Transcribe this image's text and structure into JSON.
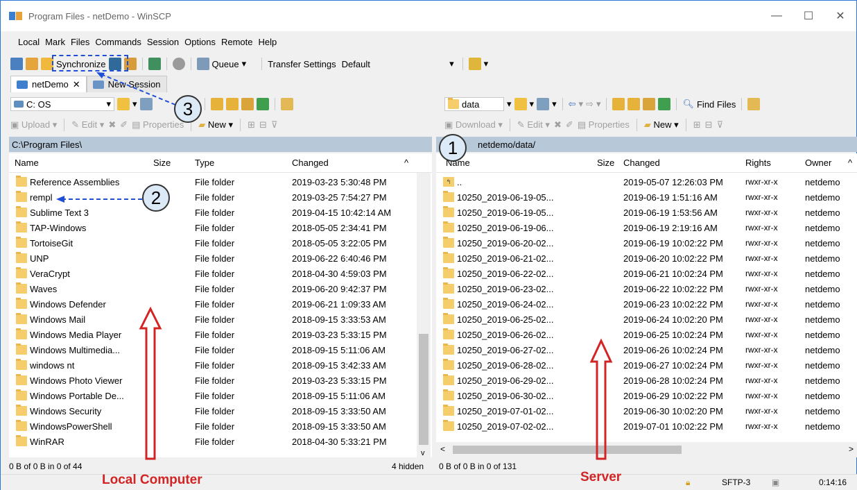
{
  "window": {
    "title": "Program Files - netDemo - WinSCP",
    "minimize": "—",
    "maximize": "☐",
    "close": "✕"
  },
  "menu": [
    "Local",
    "Mark",
    "Files",
    "Commands",
    "Session",
    "Options",
    "Remote",
    "Help"
  ],
  "toolbar": {
    "synchronize": "Synchronize",
    "queue": "Queue",
    "transfer_settings_label": "Transfer Settings",
    "transfer_settings_value": "Default"
  },
  "tabs": [
    {
      "label": "netDemo",
      "close": "✕"
    },
    {
      "label": "New Session"
    }
  ],
  "local": {
    "drive": "C: OS",
    "upload": "Upload",
    "edit": "Edit",
    "properties": "Properties",
    "new": "New",
    "path": "C:\\Program Files\\",
    "columns": {
      "name": "Name",
      "size": "Size",
      "type": "Type",
      "changed": "Changed"
    },
    "rows": [
      {
        "name": "Reference Assemblies",
        "type": "File folder",
        "changed": "2019-03-23 5:30:48 PM"
      },
      {
        "name": "rempl",
        "type": "File folder",
        "changed": "2019-03-25 7:54:27 PM"
      },
      {
        "name": "Sublime Text 3",
        "type": "File folder",
        "changed": "2019-04-15 10:42:14 AM"
      },
      {
        "name": "TAP-Windows",
        "type": "File folder",
        "changed": "2018-05-05 2:34:41 PM"
      },
      {
        "name": "TortoiseGit",
        "type": "File folder",
        "changed": "2018-05-05 3:22:05 PM"
      },
      {
        "name": "UNP",
        "type": "File folder",
        "changed": "2019-06-22 6:40:46 PM"
      },
      {
        "name": "VeraCrypt",
        "type": "File folder",
        "changed": "2018-04-30 4:59:03 PM"
      },
      {
        "name": "Waves",
        "type": "File folder",
        "changed": "2019-06-20 9:42:37 PM"
      },
      {
        "name": "Windows Defender",
        "type": "File folder",
        "changed": "2019-06-21 1:09:33 AM"
      },
      {
        "name": "Windows Mail",
        "type": "File folder",
        "changed": "2018-09-15 3:33:53 AM"
      },
      {
        "name": "Windows Media Player",
        "type": "File folder",
        "changed": "2019-03-23 5:33:15 PM"
      },
      {
        "name": "Windows Multimedia...",
        "type": "File folder",
        "changed": "2018-09-15 5:11:06 AM"
      },
      {
        "name": "windows nt",
        "type": "File folder",
        "changed": "2018-09-15 3:42:33 AM"
      },
      {
        "name": "Windows Photo Viewer",
        "type": "File folder",
        "changed": "2019-03-23 5:33:15 PM"
      },
      {
        "name": "Windows Portable De...",
        "type": "File folder",
        "changed": "2018-09-15 5:11:06 AM"
      },
      {
        "name": "Windows Security",
        "type": "File folder",
        "changed": "2018-09-15 3:33:50 AM"
      },
      {
        "name": "WindowsPowerShell",
        "type": "File folder",
        "changed": "2018-09-15 3:33:50 AM"
      },
      {
        "name": "WinRAR",
        "type": "File folder",
        "changed": "2018-04-30 5:33:21 PM"
      }
    ],
    "status": "0 B of 0 B in 0 of 44",
    "hidden": "4 hidden"
  },
  "remote": {
    "folder": "data",
    "download": "Download",
    "edit": "Edit",
    "properties": "Properties",
    "new": "New",
    "find_files": "Find Files",
    "path": "netdemo/data/",
    "columns": {
      "name": "Name",
      "size": "Size",
      "changed": "Changed",
      "rights": "Rights",
      "owner": "Owner"
    },
    "rows": [
      {
        "name": "..",
        "changed": "2019-05-07 12:26:03 PM",
        "rights": "rwxr-xr-x",
        "owner": "netdemo"
      },
      {
        "name": "10250_2019-06-19-05...",
        "changed": "2019-06-19 1:51:16 AM",
        "rights": "rwxr-xr-x",
        "owner": "netdemo"
      },
      {
        "name": "10250_2019-06-19-05...",
        "changed": "2019-06-19 1:53:56 AM",
        "rights": "rwxr-xr-x",
        "owner": "netdemo"
      },
      {
        "name": "10250_2019-06-19-06...",
        "changed": "2019-06-19 2:19:16 AM",
        "rights": "rwxr-xr-x",
        "owner": "netdemo"
      },
      {
        "name": "10250_2019-06-20-02...",
        "changed": "2019-06-19 10:02:22 PM",
        "rights": "rwxr-xr-x",
        "owner": "netdemo"
      },
      {
        "name": "10250_2019-06-21-02...",
        "changed": "2019-06-20 10:02:22 PM",
        "rights": "rwxr-xr-x",
        "owner": "netdemo"
      },
      {
        "name": "10250_2019-06-22-02...",
        "changed": "2019-06-21 10:02:24 PM",
        "rights": "rwxr-xr-x",
        "owner": "netdemo"
      },
      {
        "name": "10250_2019-06-23-02...",
        "changed": "2019-06-22 10:02:22 PM",
        "rights": "rwxr-xr-x",
        "owner": "netdemo"
      },
      {
        "name": "10250_2019-06-24-02...",
        "changed": "2019-06-23 10:02:22 PM",
        "rights": "rwxr-xr-x",
        "owner": "netdemo"
      },
      {
        "name": "10250_2019-06-25-02...",
        "changed": "2019-06-24 10:02:20 PM",
        "rights": "rwxr-xr-x",
        "owner": "netdemo"
      },
      {
        "name": "10250_2019-06-26-02...",
        "changed": "2019-06-25 10:02:24 PM",
        "rights": "rwxr-xr-x",
        "owner": "netdemo"
      },
      {
        "name": "10250_2019-06-27-02...",
        "changed": "2019-06-26 10:02:24 PM",
        "rights": "rwxr-xr-x",
        "owner": "netdemo"
      },
      {
        "name": "10250_2019-06-28-02...",
        "changed": "2019-06-27 10:02:24 PM",
        "rights": "rwxr-xr-x",
        "owner": "netdemo"
      },
      {
        "name": "10250_2019-06-29-02...",
        "changed": "2019-06-28 10:02:24 PM",
        "rights": "rwxr-xr-x",
        "owner": "netdemo"
      },
      {
        "name": "10250_2019-06-30-02...",
        "changed": "2019-06-29 10:02:22 PM",
        "rights": "rwxr-xr-x",
        "owner": "netdemo"
      },
      {
        "name": "10250_2019-07-01-02...",
        "changed": "2019-06-30 10:02:20 PM",
        "rights": "rwxr-xr-x",
        "owner": "netdemo"
      },
      {
        "name": "10250_2019-07-02-02...",
        "changed": "2019-07-01 10:02:22 PM",
        "rights": "rwxr-xr-x",
        "owner": "netdemo"
      }
    ],
    "status": "0 B of 0 B in 0 of 131"
  },
  "statusbar": {
    "protocol": "SFTP-3",
    "time": "0:14:16"
  },
  "annotations": {
    "badge1": "1",
    "badge2": "2",
    "badge3": "3",
    "local_label": "Local Computer",
    "server_label": "Server"
  },
  "colors": {
    "accent": "#2b78d6",
    "pathbar": "#b7c8d9",
    "annotation_red": "#d22424",
    "annotation_blue": "#1f4fd8"
  }
}
